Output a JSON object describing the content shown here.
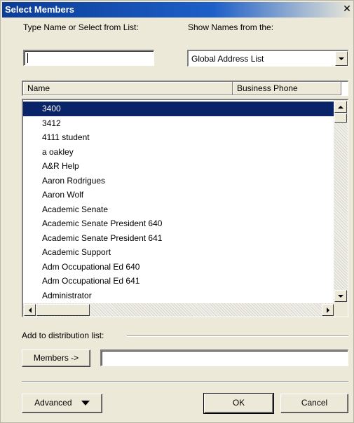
{
  "window": {
    "title": "Select Members",
    "close_glyph": "✕"
  },
  "search": {
    "label": "Type Name or Select from List:",
    "value": ""
  },
  "source": {
    "label": "Show Names from the:",
    "selected": "Global Address List"
  },
  "columns": [
    "Name",
    "Business Phone"
  ],
  "names": [
    "3400",
    "3412",
    "4111 student",
    "a oakley",
    "A&R Help",
    "Aaron Rodrigues",
    "Aaron Wolf",
    "Academic Senate",
    "Academic Senate President 640",
    "Academic Senate President 641",
    "Academic Support",
    "Adm Occupational Ed 640",
    "Adm Occupational Ed 641",
    "Administrator"
  ],
  "selected_index": 0,
  "distribution": {
    "label": "Add to distribution list:",
    "members_button": "Members ->",
    "members_value": ""
  },
  "buttons": {
    "advanced": "Advanced",
    "ok": "OK",
    "cancel": "Cancel"
  }
}
